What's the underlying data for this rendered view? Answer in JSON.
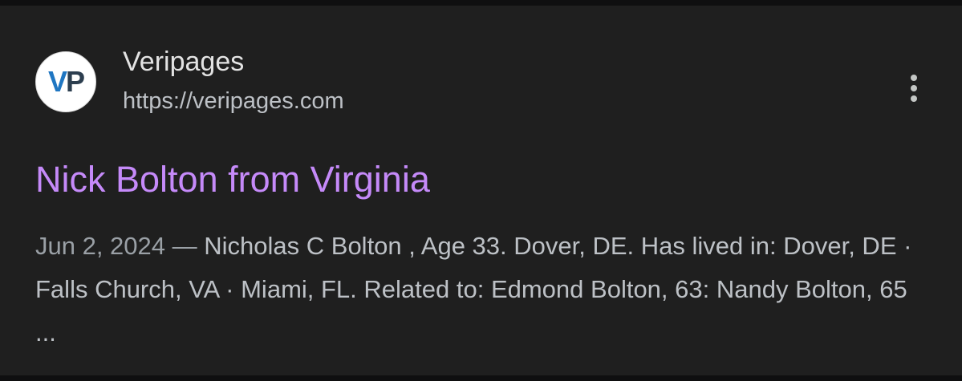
{
  "result": {
    "favicon": {
      "icon": "veripages-logo",
      "text": "VP",
      "colors": {
        "v": "#1f76c2",
        "p": "#2c3e4f"
      }
    },
    "site_name": "Veripages",
    "site_url": "https://veripages.com",
    "more_icon": "more-vert-icon",
    "title": "Nick Bolton from Virginia",
    "snippet_date": "Jun 2, 2024",
    "snippet_separator": " — ",
    "snippet_text": "Nicholas C Bolton , Age 33. Dover, DE. Has lived in: Dover, DE · Falls Church, VA · Miami, FL. Related to: Edmond Bolton, 63: Nandy Bolton, 65 ..."
  },
  "colors": {
    "page_bg": "#0f0f10",
    "card_bg": "#1f1f1f",
    "title_link": "#c58af9",
    "site_name": "#e3e3e3",
    "secondary_text": "#bdc1c6",
    "date_text": "#9aa0a6"
  }
}
